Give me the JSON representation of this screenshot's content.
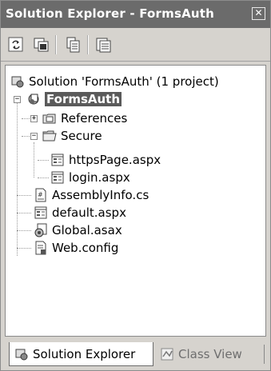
{
  "window": {
    "title": "Solution Explorer - FormsAuth",
    "close_icon": "close-icon"
  },
  "toolbar": {
    "buttons": [
      "refresh-icon",
      "show-all-files-icon",
      "properties-icon",
      "copy-project-icon"
    ]
  },
  "tree": {
    "solution": "Solution 'FormsAuth' (1 project)",
    "project": "FormsAuth",
    "references": "References",
    "secure": "Secure",
    "https_page": "httpsPage.aspx",
    "login": "login.aspx",
    "assemblyinfo": "AssemblyInfo.cs",
    "default": "default.aspx",
    "global": "Global.asax",
    "webconfig": "Web.config"
  },
  "tabs": {
    "solution_explorer": "Solution Explorer",
    "class_view": "Class View"
  }
}
